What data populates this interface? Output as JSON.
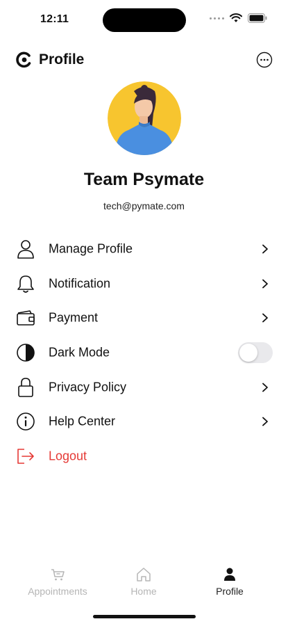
{
  "status_bar": {
    "time": "12:11"
  },
  "header": {
    "title": "Profile"
  },
  "profile": {
    "name": "Team Psymate",
    "email": "tech@pymate.com"
  },
  "menu": {
    "items": [
      {
        "label": "Manage Profile",
        "icon": "user-icon"
      },
      {
        "label": "Notification",
        "icon": "bell-icon"
      },
      {
        "label": "Payment",
        "icon": "wallet-icon"
      },
      {
        "label": "Dark Mode",
        "icon": "contrast-icon",
        "toggle_on": false
      },
      {
        "label": "Privacy Policy",
        "icon": "lock-icon"
      },
      {
        "label": "Help Center",
        "icon": "info-icon"
      },
      {
        "label": "Logout",
        "icon": "logout-icon"
      }
    ]
  },
  "tabbar": {
    "tabs": [
      {
        "label": "Appointments",
        "icon": "calendar-icon",
        "active": false
      },
      {
        "label": "Home",
        "icon": "home-icon",
        "active": false
      },
      {
        "label": "Profile",
        "icon": "person-icon",
        "active": true
      }
    ]
  },
  "colors": {
    "logout": "#e53935",
    "avatar_bg": "#f7c52f",
    "shirt": "#4a8fe0"
  }
}
